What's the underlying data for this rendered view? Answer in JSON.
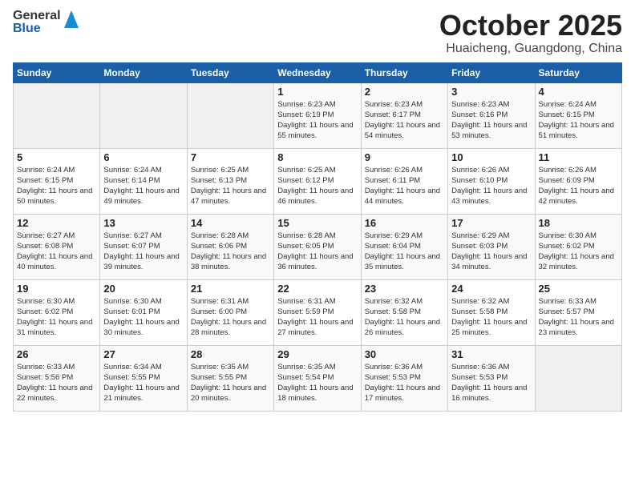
{
  "header": {
    "logo": {
      "general": "General",
      "blue": "Blue"
    },
    "title": "October 2025",
    "location": "Huaicheng, Guangdong, China"
  },
  "weekdays": [
    "Sunday",
    "Monday",
    "Tuesday",
    "Wednesday",
    "Thursday",
    "Friday",
    "Saturday"
  ],
  "weeks": [
    [
      {
        "day": "",
        "sunrise": "",
        "sunset": "",
        "daylight": ""
      },
      {
        "day": "",
        "sunrise": "",
        "sunset": "",
        "daylight": ""
      },
      {
        "day": "",
        "sunrise": "",
        "sunset": "",
        "daylight": ""
      },
      {
        "day": "1",
        "sunrise": "Sunrise: 6:23 AM",
        "sunset": "Sunset: 6:19 PM",
        "daylight": "Daylight: 11 hours and 55 minutes."
      },
      {
        "day": "2",
        "sunrise": "Sunrise: 6:23 AM",
        "sunset": "Sunset: 6:17 PM",
        "daylight": "Daylight: 11 hours and 54 minutes."
      },
      {
        "day": "3",
        "sunrise": "Sunrise: 6:23 AM",
        "sunset": "Sunset: 6:16 PM",
        "daylight": "Daylight: 11 hours and 53 minutes."
      },
      {
        "day": "4",
        "sunrise": "Sunrise: 6:24 AM",
        "sunset": "Sunset: 6:15 PM",
        "daylight": "Daylight: 11 hours and 51 minutes."
      }
    ],
    [
      {
        "day": "5",
        "sunrise": "Sunrise: 6:24 AM",
        "sunset": "Sunset: 6:15 PM",
        "daylight": "Daylight: 11 hours and 50 minutes."
      },
      {
        "day": "6",
        "sunrise": "Sunrise: 6:24 AM",
        "sunset": "Sunset: 6:14 PM",
        "daylight": "Daylight: 11 hours and 49 minutes."
      },
      {
        "day": "7",
        "sunrise": "Sunrise: 6:25 AM",
        "sunset": "Sunset: 6:13 PM",
        "daylight": "Daylight: 11 hours and 47 minutes."
      },
      {
        "day": "8",
        "sunrise": "Sunrise: 6:25 AM",
        "sunset": "Sunset: 6:12 PM",
        "daylight": "Daylight: 11 hours and 46 minutes."
      },
      {
        "day": "9",
        "sunrise": "Sunrise: 6:26 AM",
        "sunset": "Sunset: 6:11 PM",
        "daylight": "Daylight: 11 hours and 44 minutes."
      },
      {
        "day": "10",
        "sunrise": "Sunrise: 6:26 AM",
        "sunset": "Sunset: 6:10 PM",
        "daylight": "Daylight: 11 hours and 43 minutes."
      },
      {
        "day": "11",
        "sunrise": "Sunrise: 6:26 AM",
        "sunset": "Sunset: 6:09 PM",
        "daylight": "Daylight: 11 hours and 42 minutes."
      }
    ],
    [
      {
        "day": "12",
        "sunrise": "Sunrise: 6:27 AM",
        "sunset": "Sunset: 6:08 PM",
        "daylight": "Daylight: 11 hours and 40 minutes."
      },
      {
        "day": "13",
        "sunrise": "Sunrise: 6:27 AM",
        "sunset": "Sunset: 6:07 PM",
        "daylight": "Daylight: 11 hours and 39 minutes."
      },
      {
        "day": "14",
        "sunrise": "Sunrise: 6:28 AM",
        "sunset": "Sunset: 6:06 PM",
        "daylight": "Daylight: 11 hours and 38 minutes."
      },
      {
        "day": "15",
        "sunrise": "Sunrise: 6:28 AM",
        "sunset": "Sunset: 6:05 PM",
        "daylight": "Daylight: 11 hours and 36 minutes."
      },
      {
        "day": "16",
        "sunrise": "Sunrise: 6:29 AM",
        "sunset": "Sunset: 6:04 PM",
        "daylight": "Daylight: 11 hours and 35 minutes."
      },
      {
        "day": "17",
        "sunrise": "Sunrise: 6:29 AM",
        "sunset": "Sunset: 6:03 PM",
        "daylight": "Daylight: 11 hours and 34 minutes."
      },
      {
        "day": "18",
        "sunrise": "Sunrise: 6:30 AM",
        "sunset": "Sunset: 6:02 PM",
        "daylight": "Daylight: 11 hours and 32 minutes."
      }
    ],
    [
      {
        "day": "19",
        "sunrise": "Sunrise: 6:30 AM",
        "sunset": "Sunset: 6:02 PM",
        "daylight": "Daylight: 11 hours and 31 minutes."
      },
      {
        "day": "20",
        "sunrise": "Sunrise: 6:30 AM",
        "sunset": "Sunset: 6:01 PM",
        "daylight": "Daylight: 11 hours and 30 minutes."
      },
      {
        "day": "21",
        "sunrise": "Sunrise: 6:31 AM",
        "sunset": "Sunset: 6:00 PM",
        "daylight": "Daylight: 11 hours and 28 minutes."
      },
      {
        "day": "22",
        "sunrise": "Sunrise: 6:31 AM",
        "sunset": "Sunset: 5:59 PM",
        "daylight": "Daylight: 11 hours and 27 minutes."
      },
      {
        "day": "23",
        "sunrise": "Sunrise: 6:32 AM",
        "sunset": "Sunset: 5:58 PM",
        "daylight": "Daylight: 11 hours and 26 minutes."
      },
      {
        "day": "24",
        "sunrise": "Sunrise: 6:32 AM",
        "sunset": "Sunset: 5:58 PM",
        "daylight": "Daylight: 11 hours and 25 minutes."
      },
      {
        "day": "25",
        "sunrise": "Sunrise: 6:33 AM",
        "sunset": "Sunset: 5:57 PM",
        "daylight": "Daylight: 11 hours and 23 minutes."
      }
    ],
    [
      {
        "day": "26",
        "sunrise": "Sunrise: 6:33 AM",
        "sunset": "Sunset: 5:56 PM",
        "daylight": "Daylight: 11 hours and 22 minutes."
      },
      {
        "day": "27",
        "sunrise": "Sunrise: 6:34 AM",
        "sunset": "Sunset: 5:55 PM",
        "daylight": "Daylight: 11 hours and 21 minutes."
      },
      {
        "day": "28",
        "sunrise": "Sunrise: 6:35 AM",
        "sunset": "Sunset: 5:55 PM",
        "daylight": "Daylight: 11 hours and 20 minutes."
      },
      {
        "day": "29",
        "sunrise": "Sunrise: 6:35 AM",
        "sunset": "Sunset: 5:54 PM",
        "daylight": "Daylight: 11 hours and 18 minutes."
      },
      {
        "day": "30",
        "sunrise": "Sunrise: 6:36 AM",
        "sunset": "Sunset: 5:53 PM",
        "daylight": "Daylight: 11 hours and 17 minutes."
      },
      {
        "day": "31",
        "sunrise": "Sunrise: 6:36 AM",
        "sunset": "Sunset: 5:53 PM",
        "daylight": "Daylight: 11 hours and 16 minutes."
      },
      {
        "day": "",
        "sunrise": "",
        "sunset": "",
        "daylight": ""
      }
    ]
  ]
}
